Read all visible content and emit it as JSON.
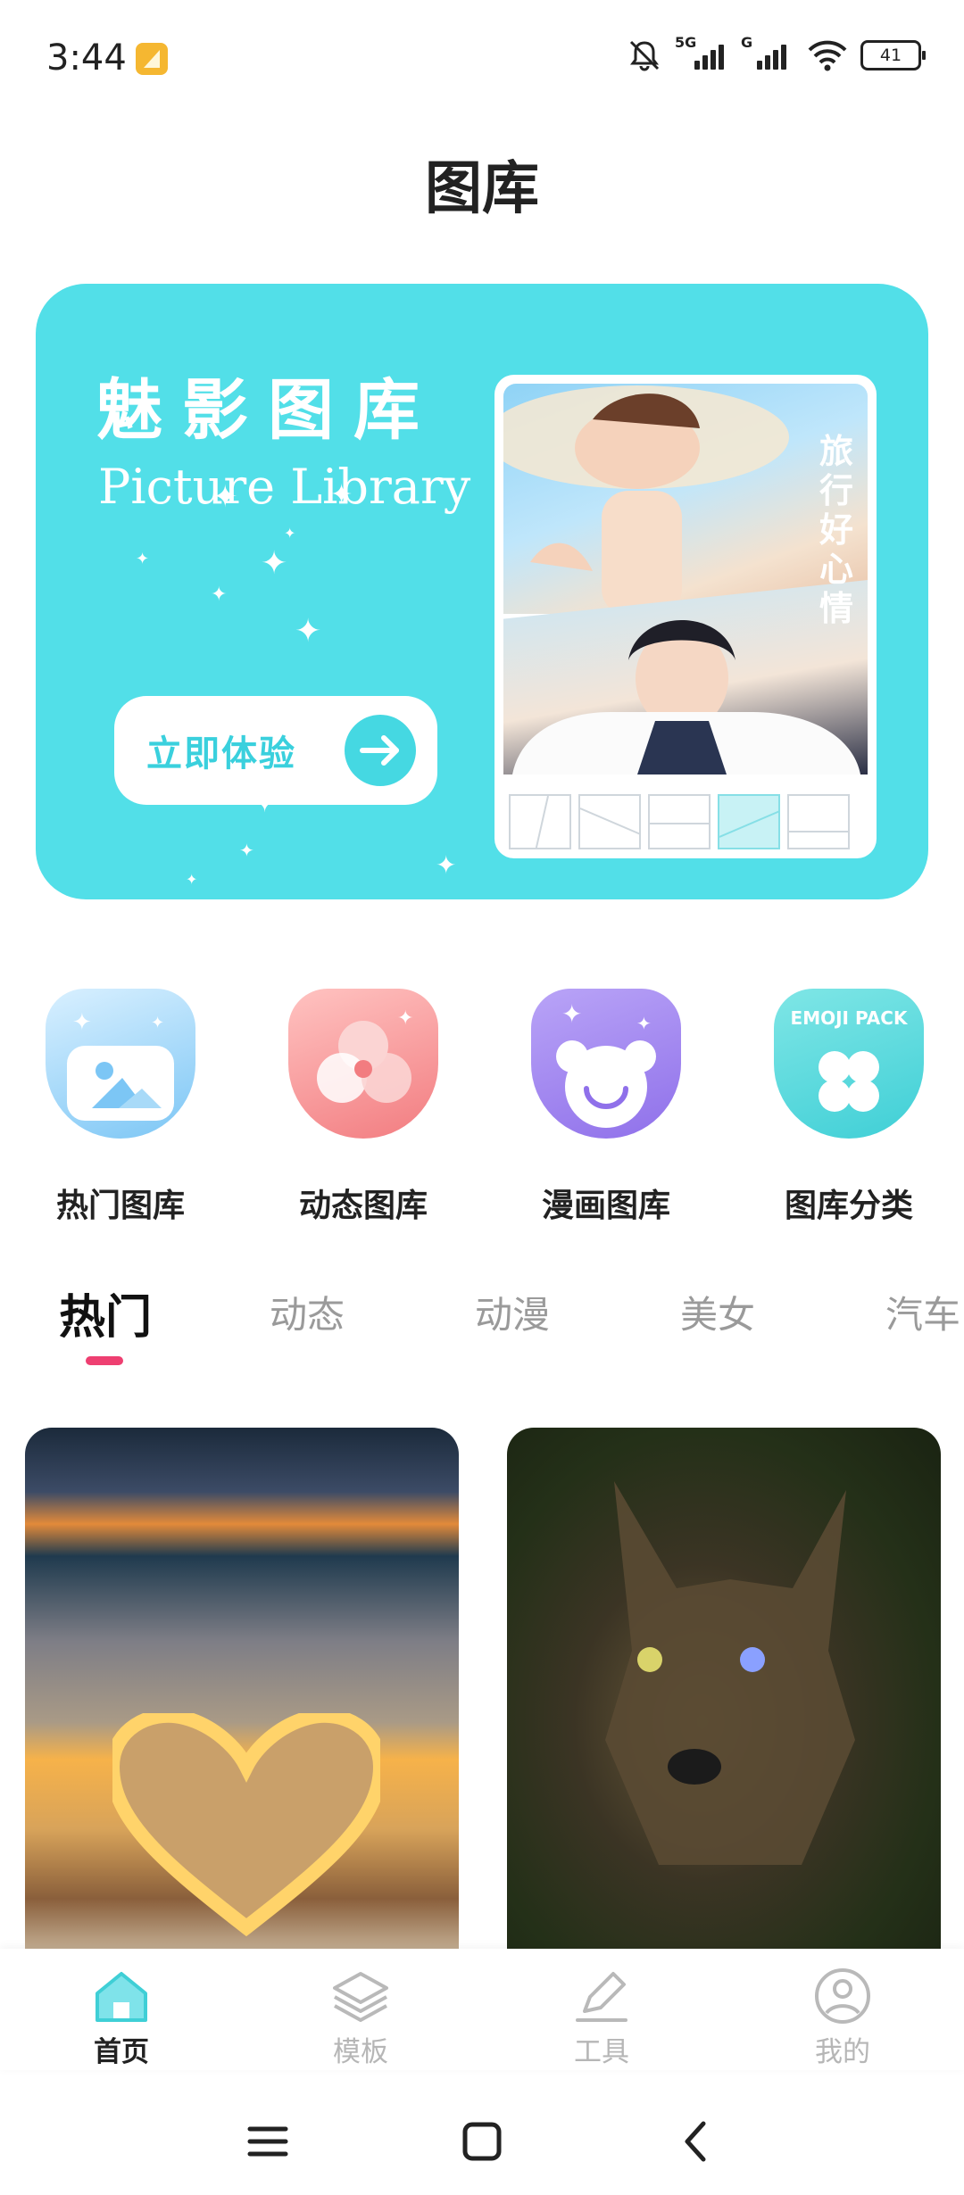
{
  "status_bar": {
    "time": "3:44",
    "network_1": "5G",
    "network_2": "G",
    "battery": "41"
  },
  "page": {
    "title": "图库"
  },
  "banner": {
    "title": "魅影图库",
    "subtitle": "Picture Library",
    "button_label": "立即体验",
    "vertical_text": "旅行好心情",
    "accent": "#52dfe8"
  },
  "quick_categories": [
    {
      "label": "热门图库",
      "icon": "picture-icon"
    },
    {
      "label": "动态图库",
      "icon": "swirl-icon"
    },
    {
      "label": "漫画图库",
      "icon": "bear-icon"
    },
    {
      "label": "图库分类",
      "icon": "clover-icon",
      "badge": "EMOJI PACK"
    }
  ],
  "tabs": {
    "items": [
      "热门",
      "动态",
      "动漫",
      "美女",
      "汽车"
    ],
    "active": "热门",
    "indicator_color": "#ee3f71"
  },
  "images": [
    {
      "subject": "glowing heart on pebble beach"
    },
    {
      "subject": "wolf"
    }
  ],
  "bottom_nav": {
    "items": [
      {
        "label": "首页",
        "icon": "home-icon",
        "active": true
      },
      {
        "label": "模板",
        "icon": "layers-icon",
        "active": false
      },
      {
        "label": "工具",
        "icon": "pencil-icon",
        "active": false
      },
      {
        "label": "我的",
        "icon": "profile-icon",
        "active": false
      }
    ]
  }
}
